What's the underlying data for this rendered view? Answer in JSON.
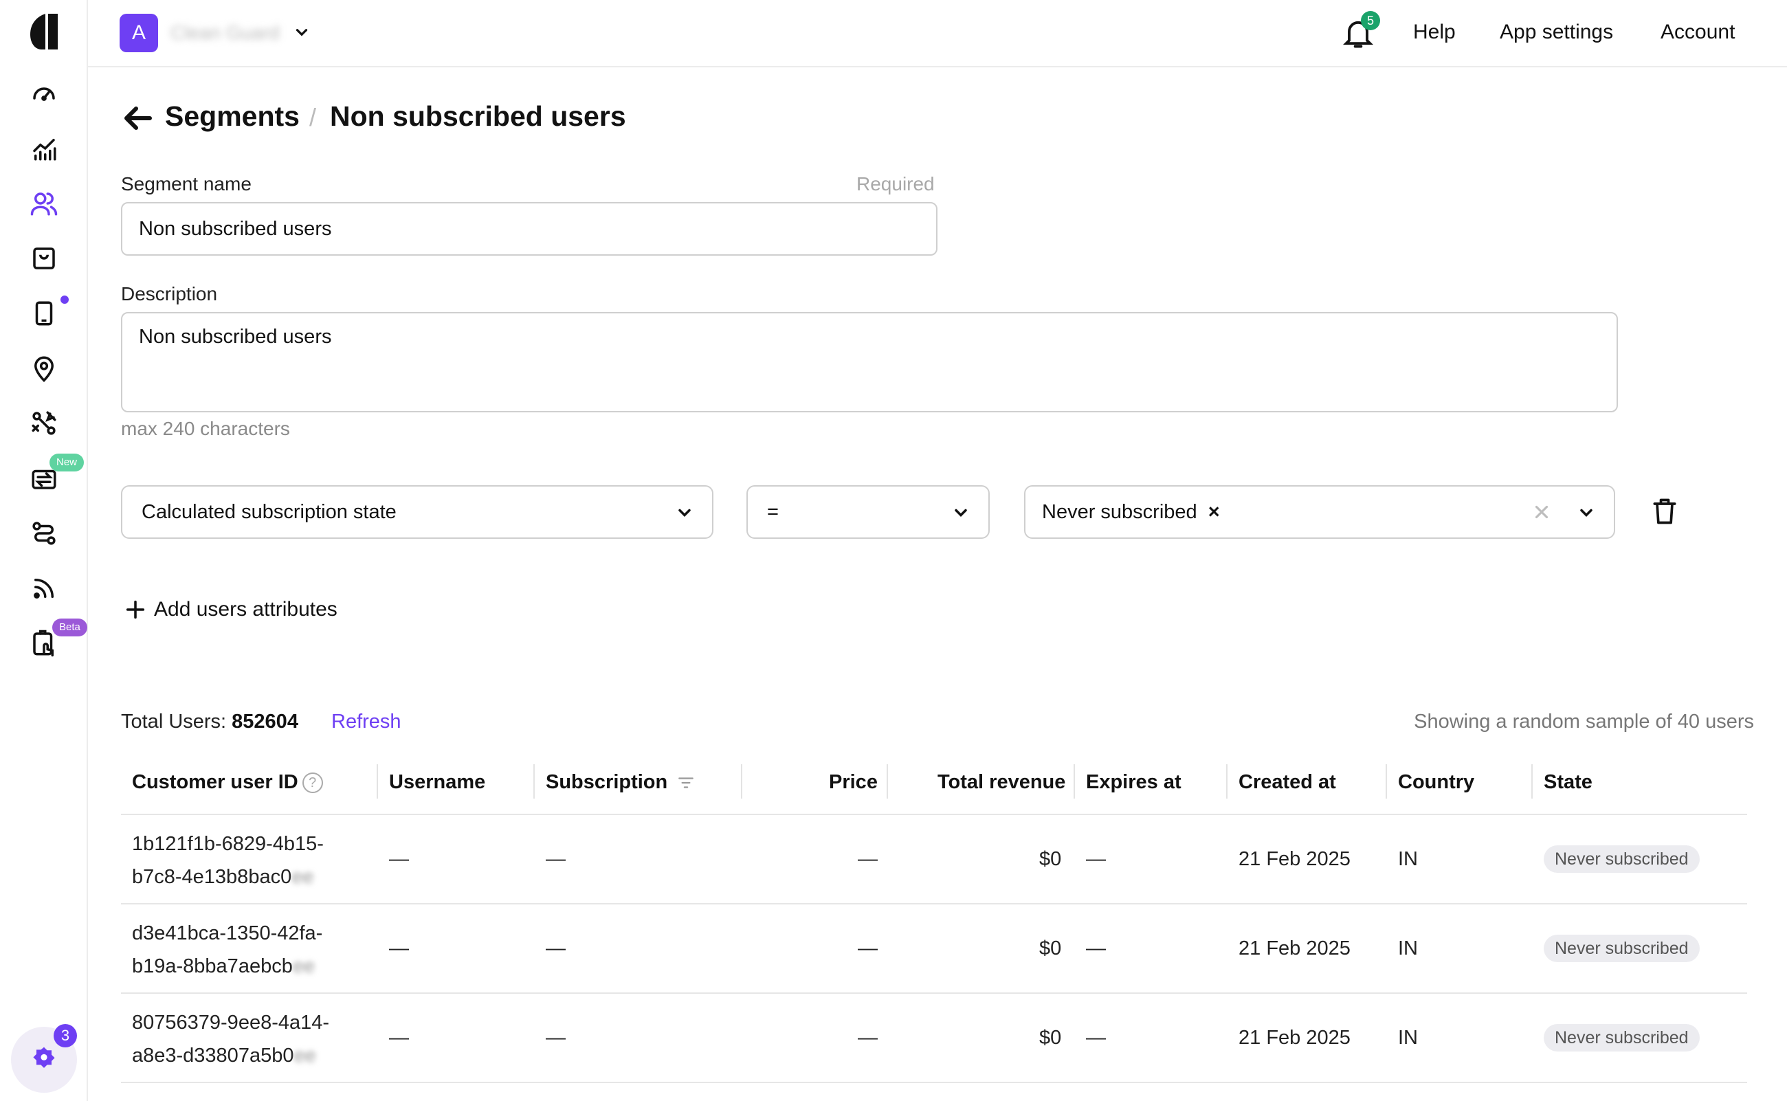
{
  "sidebar": {
    "logo": "app-logo",
    "items": [
      {
        "name": "dashboard-icon"
      },
      {
        "name": "analytics-icon"
      },
      {
        "name": "users-icon"
      },
      {
        "name": "products-icon"
      },
      {
        "name": "paywalls-icon"
      },
      {
        "name": "placements-icon"
      },
      {
        "name": "ab-tests-icon"
      },
      {
        "name": "integrations-icon"
      },
      {
        "name": "flows-icon"
      },
      {
        "name": "events-feed-icon"
      },
      {
        "name": "onboarding-icon"
      }
    ],
    "new_badge": "New",
    "beta_badge": "Beta",
    "bottom_count": "3"
  },
  "topbar": {
    "app_initial": "A",
    "app_name": "Clean Guard",
    "notifications_count": "5",
    "help": "Help",
    "app_settings": "App settings",
    "account": "Account"
  },
  "breadcrumb": {
    "parent": "Segments",
    "separator": "/",
    "current": "Non subscribed users"
  },
  "form": {
    "segment_name_label": "Segment name",
    "segment_name_required": "Required",
    "segment_name_value": "Non subscribed users",
    "description_label": "Description",
    "description_value": "Non subscribed users",
    "description_hint": "max 240 characters"
  },
  "filter": {
    "attribute": "Calculated subscription state",
    "operator": "=",
    "value": "Never subscribed",
    "value_remove": "×"
  },
  "add_attributes": "Add users attributes",
  "summary": {
    "total_label": "Total Users:",
    "total_value": "852604",
    "refresh": "Refresh",
    "sample_note": "Showing a random sample of 40 users"
  },
  "table": {
    "columns": [
      "Customer user ID",
      "Username",
      "Subscription",
      "Price",
      "Total revenue",
      "Expires at",
      "Created at",
      "Country",
      "State"
    ],
    "rows": [
      {
        "id_line1": "1b121f1b-6829-4b15-",
        "id_line2": "b7c8-4e13b8bac0",
        "id_hidden": "ee",
        "username": "—",
        "subscription": "—",
        "price": "—",
        "revenue": "$0",
        "expires": "—",
        "created": "21 Feb 2025",
        "country": "IN",
        "state": "Never subscribed"
      },
      {
        "id_line1": "d3e41bca-1350-42fa-",
        "id_line2": "b19a-8bba7aebcb",
        "id_hidden": "ee",
        "username": "—",
        "subscription": "—",
        "price": "—",
        "revenue": "$0",
        "expires": "—",
        "created": "21 Feb 2025",
        "country": "IN",
        "state": "Never subscribed"
      },
      {
        "id_line1": "80756379-9ee8-4a14-",
        "id_line2": "a8e3-d33807a5b0",
        "id_hidden": "ee",
        "username": "—",
        "subscription": "—",
        "price": "—",
        "revenue": "$0",
        "expires": "—",
        "created": "21 Feb 2025",
        "country": "IN",
        "state": "Never subscribed"
      }
    ]
  },
  "colors": {
    "accent": "#6e3ff3",
    "success": "#1aa36a",
    "border": "#cfcfcf"
  }
}
